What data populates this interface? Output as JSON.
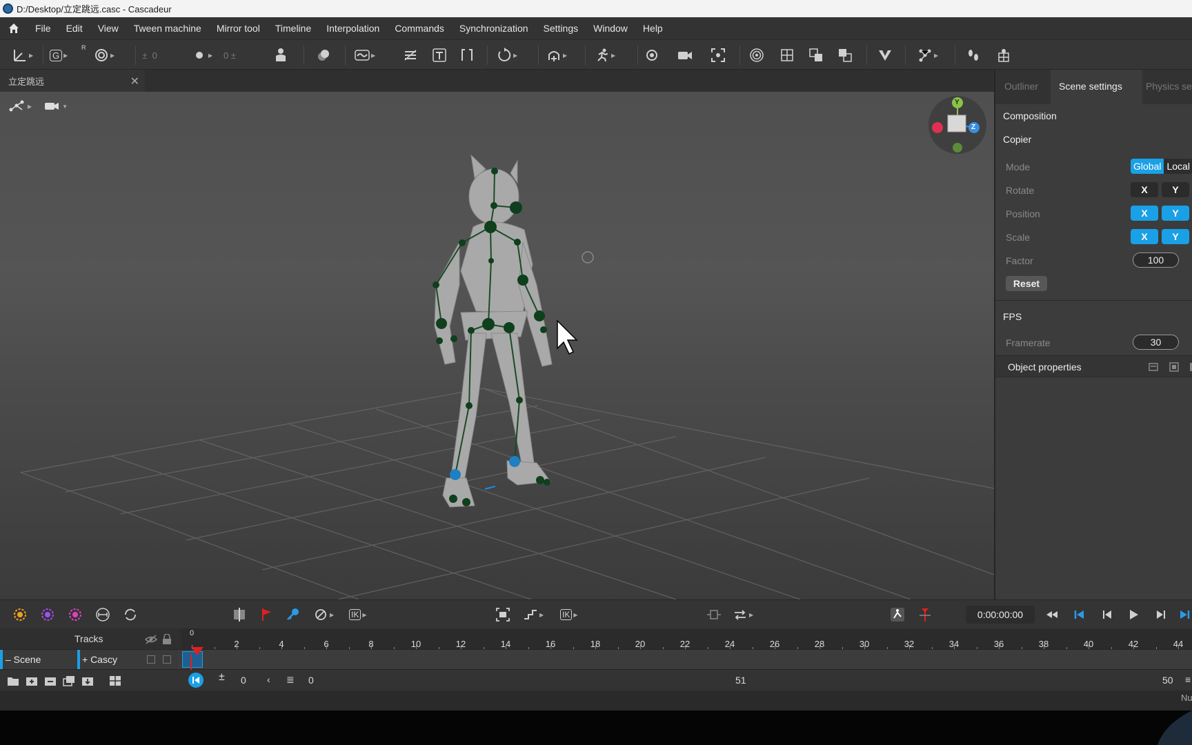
{
  "window": {
    "title": "D:/Desktop/立定跳远.casc - Cascadeur"
  },
  "menu": [
    "File",
    "Edit",
    "View",
    "Tween machine",
    "Mirror tool",
    "Timeline",
    "Interpolation",
    "Commands",
    "Synchronization",
    "Settings",
    "Window",
    "Help"
  ],
  "toolbar": {
    "counter_a": "0",
    "counter_b": "0",
    "g_label": "G",
    "r_label": "R",
    "ik_label": "IK"
  },
  "document_tab": {
    "label": "立定跳远",
    "close": "✕"
  },
  "viewport": {
    "gizmo": {
      "y": "Y",
      "z": "Z"
    }
  },
  "right_panel": {
    "tabs": [
      "Outliner",
      "Scene settings",
      "Physics se"
    ],
    "active_tab": "Scene settings",
    "composition": "Composition",
    "copier": {
      "title": "Copier",
      "mode_label": "Mode",
      "mode_options": [
        "Global",
        "Local"
      ],
      "mode_selected": "Global",
      "rotate_label": "Rotate",
      "rotate": {
        "x": "X",
        "y": "Y",
        "x_on": false,
        "y_on": false
      },
      "position_label": "Position",
      "position": {
        "x": "X",
        "y": "Y",
        "x_on": true,
        "y_on": true
      },
      "scale_label": "Scale",
      "scale": {
        "x": "X",
        "y": "Y",
        "x_on": true,
        "y_on": true
      },
      "factor_label": "Factor",
      "factor_value": "100",
      "reset_label": "Reset"
    },
    "fps": {
      "title": "FPS",
      "framerate_label": "Framerate",
      "framerate_value": "30"
    },
    "object_properties": "Object properties"
  },
  "playbar": {
    "ik_label": "IK",
    "ik_label2": "IK",
    "timecode": "0:00:00:00"
  },
  "timeline": {
    "tracks_label": "Tracks",
    "ruler_ticks": [
      "0",
      "2",
      "4",
      "6",
      "8",
      "10",
      "12",
      "14",
      "16",
      "18",
      "20",
      "22",
      "24",
      "26",
      "28",
      "30",
      "32",
      "34",
      "36",
      "38",
      "40",
      "42",
      "44"
    ],
    "scene_label": "– Scene",
    "object_label": "+ Cascy",
    "frame_start": "0",
    "frame_current": "0",
    "frame_mid": "51",
    "frame_end": "50",
    "corner_text": "Nu"
  },
  "colors": {
    "accent": "#1aa0e6",
    "joint": "#0f3f1c",
    "marker": "#e02020"
  }
}
